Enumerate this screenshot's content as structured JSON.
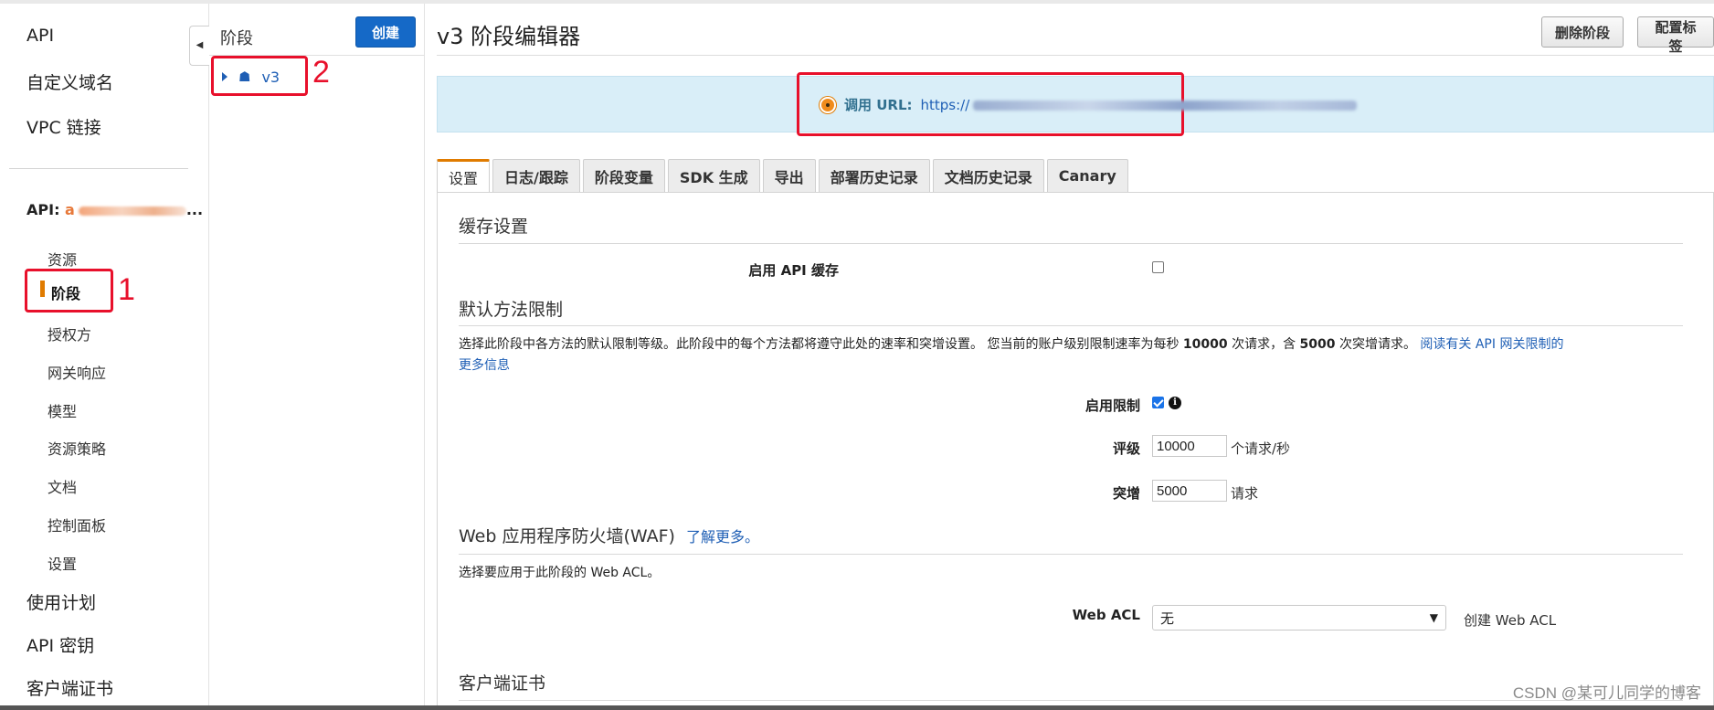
{
  "leftnav": {
    "top_items": [
      "API",
      "自定义域名",
      "VPC 链接"
    ],
    "api_label": "API: ",
    "api_name_visible": "a",
    "api_name_tail": "...",
    "sub_items": [
      "资源",
      "阶段",
      "授权方",
      "网关响应",
      "模型",
      "资源策略",
      "文档",
      "控制面板",
      "设置"
    ],
    "active_item": "阶段",
    "bottom_items": [
      "使用计划",
      "API 密钥",
      "客户端证书"
    ],
    "annotation_number": "1"
  },
  "stages": {
    "title": "阶段",
    "create_label": "创建",
    "items": [
      {
        "name": "v3"
      }
    ],
    "annotation_number": "2"
  },
  "header": {
    "title": "v3 阶段编辑器",
    "delete_label": "删除阶段",
    "tags_label": "配置标签"
  },
  "invoke": {
    "label": "调用 URL:",
    "url_prefix": "https://"
  },
  "tabs": [
    {
      "label": "设置",
      "active": true
    },
    {
      "label": "日志/跟踪"
    },
    {
      "label": "阶段变量"
    },
    {
      "label": "SDK 生成"
    },
    {
      "label": "导出"
    },
    {
      "label": "部署历史记录"
    },
    {
      "label": "文档历史记录"
    },
    {
      "label": "Canary"
    }
  ],
  "cache": {
    "section_title": "缓存设置",
    "enable_label": "启用 API 缓存",
    "enabled": false
  },
  "throttle": {
    "section_title": "默认方法限制",
    "desc_before": "选择此阶段中各方法的默认限制等级。此阶段中的每个方法都将遵守此处的速率和突增设置。 您当前的账户级别限制速率为每秒 ",
    "rate_limit": "10000",
    "desc_middle": " 次请求，含 ",
    "burst_limit": "5000",
    "desc_after": " 次突增请求。 ",
    "read_more_link": "阅读有关 API 网关限制的",
    "read_more_link_2": "更多信息",
    "enable_label": "启用限制",
    "enabled": true,
    "rate_label": "评级",
    "rate_value": "10000",
    "rate_unit": "个请求/秒",
    "burst_label": "突增",
    "burst_value": "5000",
    "burst_unit": "请求"
  },
  "waf": {
    "section_title": "Web 应用程序防火墙(WAF)",
    "learn_more": "了解更多。",
    "desc": "选择要应用于此阶段的 Web ACL。",
    "acl_label": "Web ACL",
    "acl_value": "无",
    "create_link": "创建 Web ACL"
  },
  "client_cert": {
    "section_title": "客户端证书"
  },
  "watermark": "CSDN @某可儿同学的博客"
}
